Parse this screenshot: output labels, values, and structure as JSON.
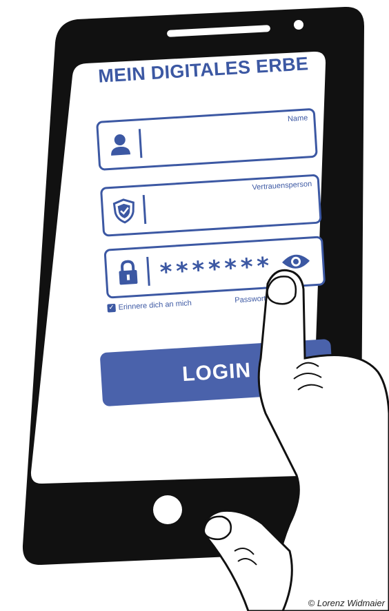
{
  "app": {
    "title": "MEIN DIGITALES ERBE"
  },
  "fields": {
    "name": {
      "label": "Name",
      "value": ""
    },
    "trusted_person": {
      "label": "Vertrauensperson",
      "value": ""
    },
    "password": {
      "value": "*******"
    }
  },
  "remember_me": {
    "label": "Erinnere dich an mich",
    "checked": true
  },
  "forgot_password": {
    "label": "Passwort verg"
  },
  "login_button": {
    "label": "LOGIN"
  },
  "credit": "© Lorenz Widmaier",
  "icons": [
    "user-icon",
    "shield-icon",
    "lock-icon",
    "eye-icon",
    "checkbox-checked-icon"
  ],
  "colors": {
    "accent": "#3c58a3",
    "button": "#4a62ab",
    "phone_body": "#111111",
    "screen": "#ffffff"
  }
}
